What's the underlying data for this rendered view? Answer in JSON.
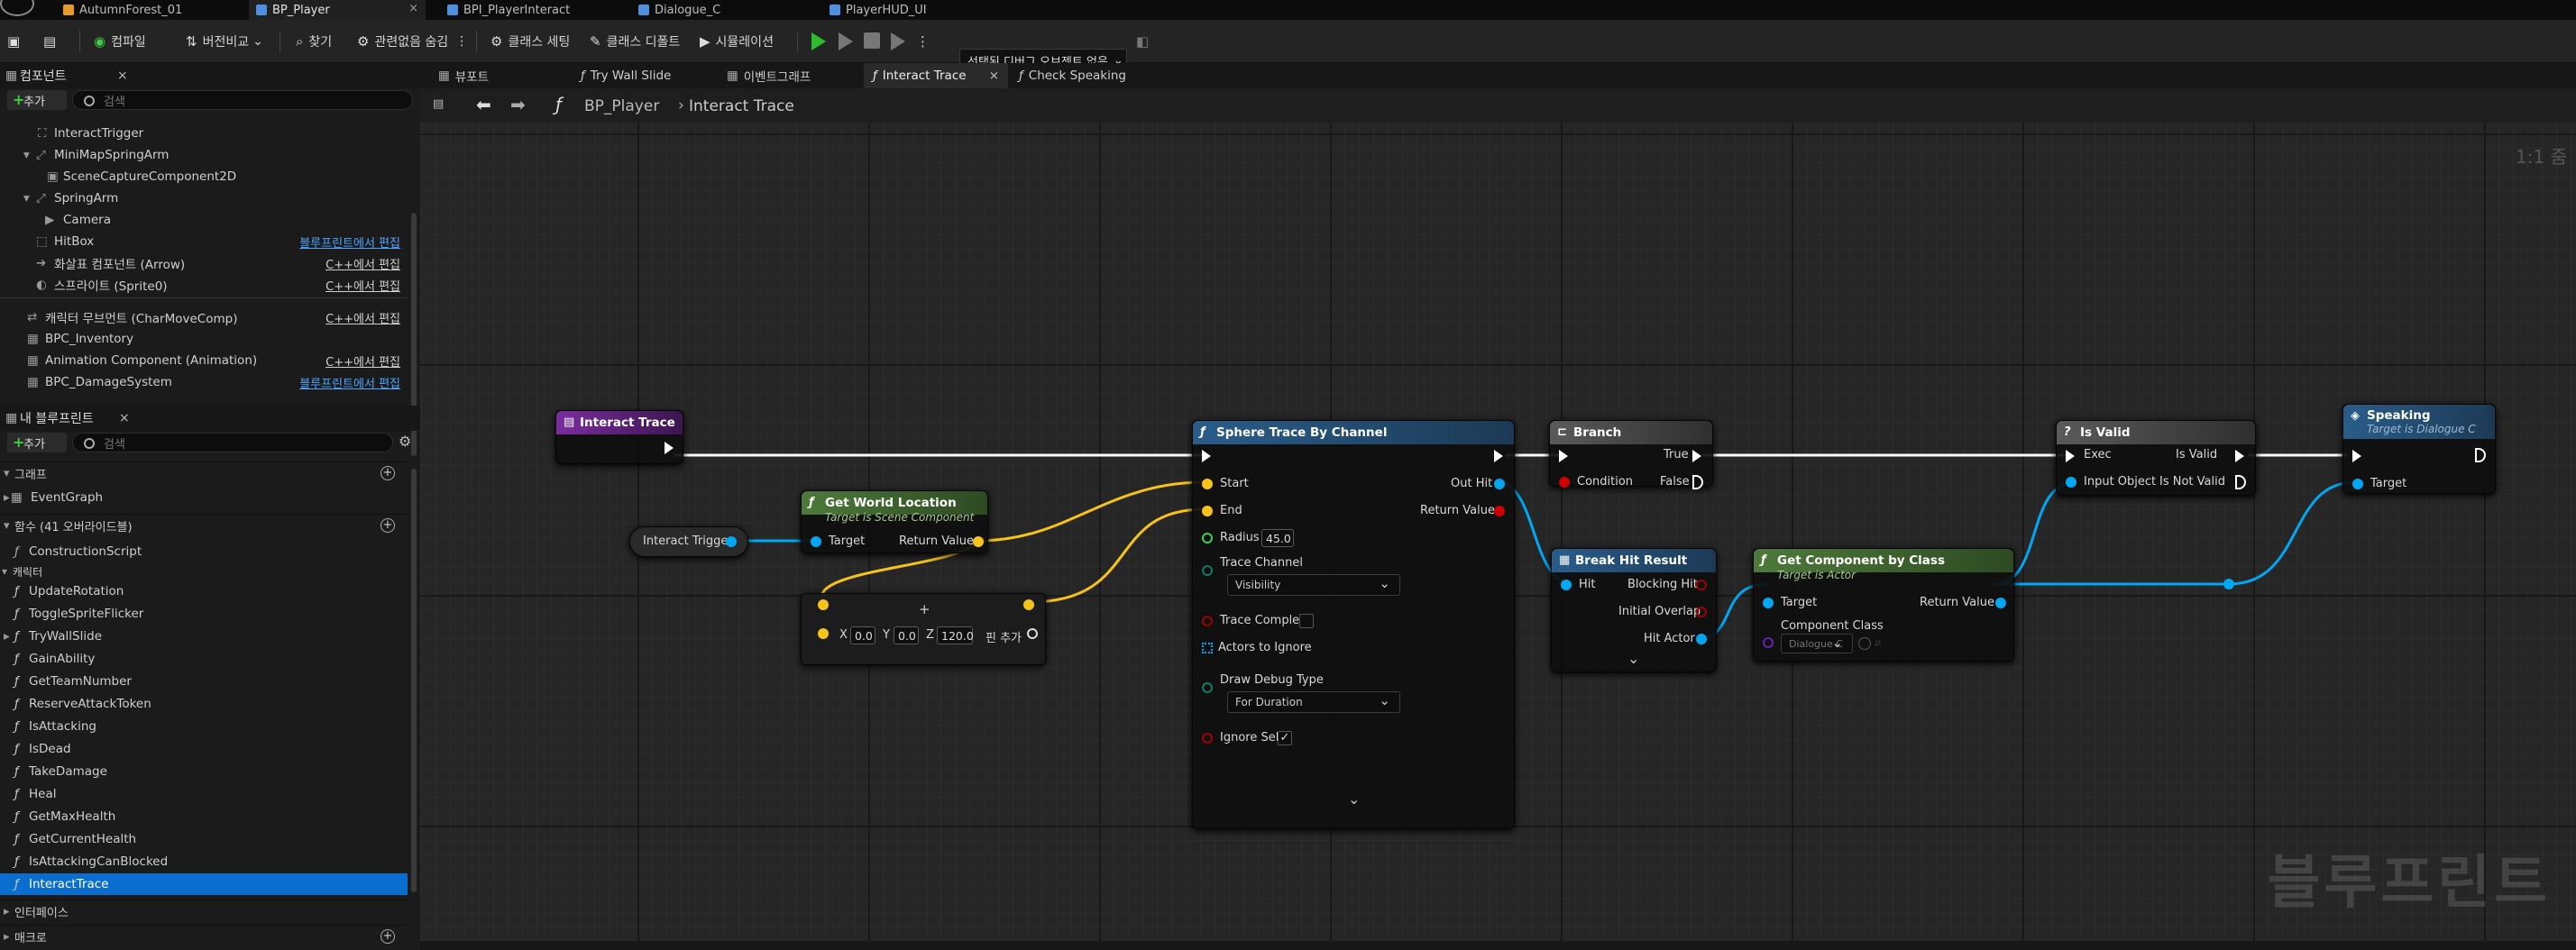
{
  "file_tabs": [
    {
      "label": "AutumnForest_01",
      "color": "#e89b2c"
    },
    {
      "label": "BP_Player",
      "color": "#4f8fe0"
    },
    {
      "label": "BPI_PlayerInteract",
      "color": "#4f8fe0"
    },
    {
      "label": "Dialogue_C",
      "color": "#4f8fe0"
    },
    {
      "label": "PlayerHUD_UI",
      "color": "#4f8fe0"
    }
  ],
  "toolbar": {
    "compile": "컴파일",
    "diff": "버전비교",
    "find": "찾기",
    "hide_unrelated": "관련없음 숨김",
    "class_settings": "클래스 세팅",
    "class_defaults": "클래스 디폴트",
    "simulation": "시뮬레이션",
    "debug_object": "선택된 디버그 오브젝트 없음"
  },
  "components": {
    "title": "컴포넌트",
    "add": "추가",
    "search_placeholder": "검색",
    "items": [
      {
        "label": "InteractTrigger",
        "right": ""
      },
      {
        "label": "MiniMapSpringArm",
        "right": ""
      },
      {
        "label": "SceneCaptureComponent2D",
        "right": ""
      },
      {
        "label": "SpringArm",
        "right": ""
      },
      {
        "label": "Camera",
        "right": ""
      },
      {
        "label": "HitBox",
        "right": "블루프린트에서 편집"
      },
      {
        "label": "화살표 컴포넌트 (Arrow)",
        "right": "C++에서 편집"
      },
      {
        "label": "스프라이트 (Sprite0)",
        "right": "C++에서 편집"
      },
      {
        "label": "캐릭터 무브먼트 (CharMoveComp)",
        "right": "C++에서 편집"
      },
      {
        "label": "BPC_Inventory",
        "right": ""
      },
      {
        "label": "Animation Component (Animation)",
        "right": "C++에서 편집"
      },
      {
        "label": "BPC_DamageSystem",
        "right": "블루프린트에서 편집"
      }
    ]
  },
  "my_blueprint": {
    "title": "내 블루프린트",
    "add": "추가",
    "search_placeholder": "검색",
    "graphs_header": "그래프",
    "event_graph": "EventGraph",
    "functions_header": "함수 (41 오버라이드블)",
    "construction": "ConstructionScript",
    "category": "캐릭터",
    "functions": [
      "UpdateRotation",
      "ToggleSpriteFlicker",
      "TryWallSlide",
      "GainAbility",
      "GetTeamNumber",
      "ReserveAttackToken",
      "IsAttacking",
      "IsDead",
      "TakeDamage",
      "Heal",
      "GetMaxHealth",
      "GetCurrentHealth",
      "IsAttackingCanBlocked",
      "InteractTrace"
    ],
    "interfaces_header": "인터페이스",
    "macros_header": "매크로"
  },
  "graph_tabs": [
    "뷰포트",
    "Try Wall Slide",
    "이벤트그래프",
    "Interact Trace",
    "Check Speaking"
  ],
  "breadcrumb": {
    "root": "BP_Player",
    "leaf": "Interact Trace"
  },
  "zoom": "1:1 줌",
  "watermark": "블루프린트",
  "nodes": {
    "entry": {
      "title": "Interact Trace"
    },
    "gwl": {
      "title": "Get World Location",
      "subtitle": "Target is Scene Component",
      "target": "Target",
      "ret": "Return Value"
    },
    "var": {
      "label": "Interact Trigger"
    },
    "add": {
      "x_label": "X",
      "x": "0.0",
      "y_label": "Y",
      "y": "0.0",
      "z_label": "Z",
      "z": "120.0",
      "add_pin": "핀 추가"
    },
    "sphere": {
      "title": "Sphere Trace By Channel",
      "start": "Start",
      "end": "End",
      "radius_label": "Radius",
      "radius": "45.0",
      "trace_channel": "Trace Channel",
      "trace_channel_val": "Visibility",
      "trace_complex": "Trace Complex",
      "actors_ignore": "Actors to Ignore",
      "draw_debug": "Draw Debug Type",
      "draw_debug_val": "For Duration",
      "ignore_self": "Ignore Self",
      "out_hit": "Out Hit",
      "ret": "Return Value"
    },
    "branch": {
      "title": "Branch",
      "condition": "Condition",
      "true": "True",
      "false": "False"
    },
    "bhr": {
      "title": "Break Hit Result",
      "hit": "Hit",
      "blocking": "Blocking Hit",
      "overlap": "Initial Overlap",
      "actor": "Hit Actor"
    },
    "gcc": {
      "title": "Get Component by Class",
      "subtitle": "Target is Actor",
      "target": "Target",
      "ret": "Return Value",
      "cclass": "Component Class",
      "cclass_val": "Dialogue C"
    },
    "isvalid": {
      "title": "Is Valid",
      "exec": "Exec",
      "input": "Input Object",
      "valid": "Is Valid",
      "notvalid": "Is Not Valid"
    },
    "speaking": {
      "title": "Speaking",
      "subtitle": "Target is Dialogue C",
      "target": "Target"
    }
  }
}
